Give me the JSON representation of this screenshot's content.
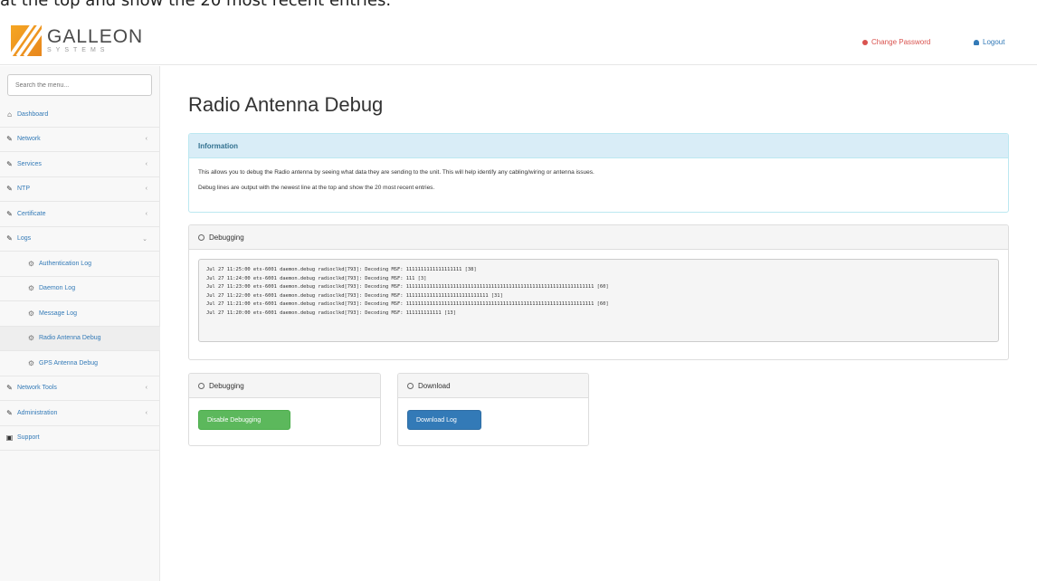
{
  "caption": "at the top and show the 20 most recent entries.",
  "header": {
    "logo_name": "GALLEON",
    "logo_sub": "SYSTEMS",
    "change_password": "Change Password",
    "logout": "Logout"
  },
  "sidebar": {
    "search_placeholder": "Search the menu...",
    "items": [
      {
        "label": "Dashboard",
        "icon": "home-icon"
      },
      {
        "label": "Network",
        "icon": "wrench-icon"
      },
      {
        "label": "Services",
        "icon": "wrench-icon"
      },
      {
        "label": "NTP",
        "icon": "wrench-icon"
      },
      {
        "label": "Certificate",
        "icon": "wrench-icon"
      },
      {
        "label": "Logs",
        "icon": "wrench-icon"
      },
      {
        "label": "Authentication Log",
        "icon": "gears-icon"
      },
      {
        "label": "Daemon Log",
        "icon": "gears-icon"
      },
      {
        "label": "Message Log",
        "icon": "gears-icon"
      },
      {
        "label": "Radio Antenna Debug",
        "icon": "gears-icon"
      },
      {
        "label": "GPS Antenna Debug",
        "icon": "gears-icon"
      },
      {
        "label": "Network Tools",
        "icon": "wrench-icon"
      },
      {
        "label": "Administration",
        "icon": "wrench-icon"
      },
      {
        "label": "Support",
        "icon": "support-icon"
      }
    ]
  },
  "main": {
    "title": "Radio Antenna Debug",
    "info": {
      "heading": "Information",
      "line1": "This allows you to debug the Radio antenna by seeing what data they are sending to the unit. This will help identify any cabling/wiring or antenna issues.",
      "line2": "Debug lines are output with the newest line at the top and show the 20 most recent entries."
    },
    "debug_panel": {
      "heading": "Debugging",
      "log_lines": [
        "Jul 27 11:25:00 ets-6001 daemon.debug radioclkd[793]: Decoding MSF: 1111111111111111111 [38]",
        "Jul 27 11:24:00 ets-6001 daemon.debug radioclkd[793]: Decoding MSF: 111 [3]",
        "Jul 27 11:23:00 ets-6001 daemon.debug radioclkd[793]: Decoding MSF: 1111111111111111111111111111111111111111111111111111111111111111 [60]",
        "Jul 27 11:22:00 ets-6001 daemon.debug radioclkd[793]: Decoding MSF: 1111111111111111111111111111 [31]",
        "Jul 27 11:21:00 ets-6001 daemon.debug radioclkd[793]: Decoding MSF: 1111111111111111111111111111111111111111111111111111111111111111 [60]",
        "Jul 27 11:20:00 ets-6001 daemon.debug radioclkd[793]: Decoding MSF: 111111111111 [13]"
      ]
    },
    "debug_control": {
      "heading": "Debugging",
      "button": "Disable Debugging"
    },
    "download": {
      "heading": "Download",
      "button": "Download Log"
    }
  }
}
